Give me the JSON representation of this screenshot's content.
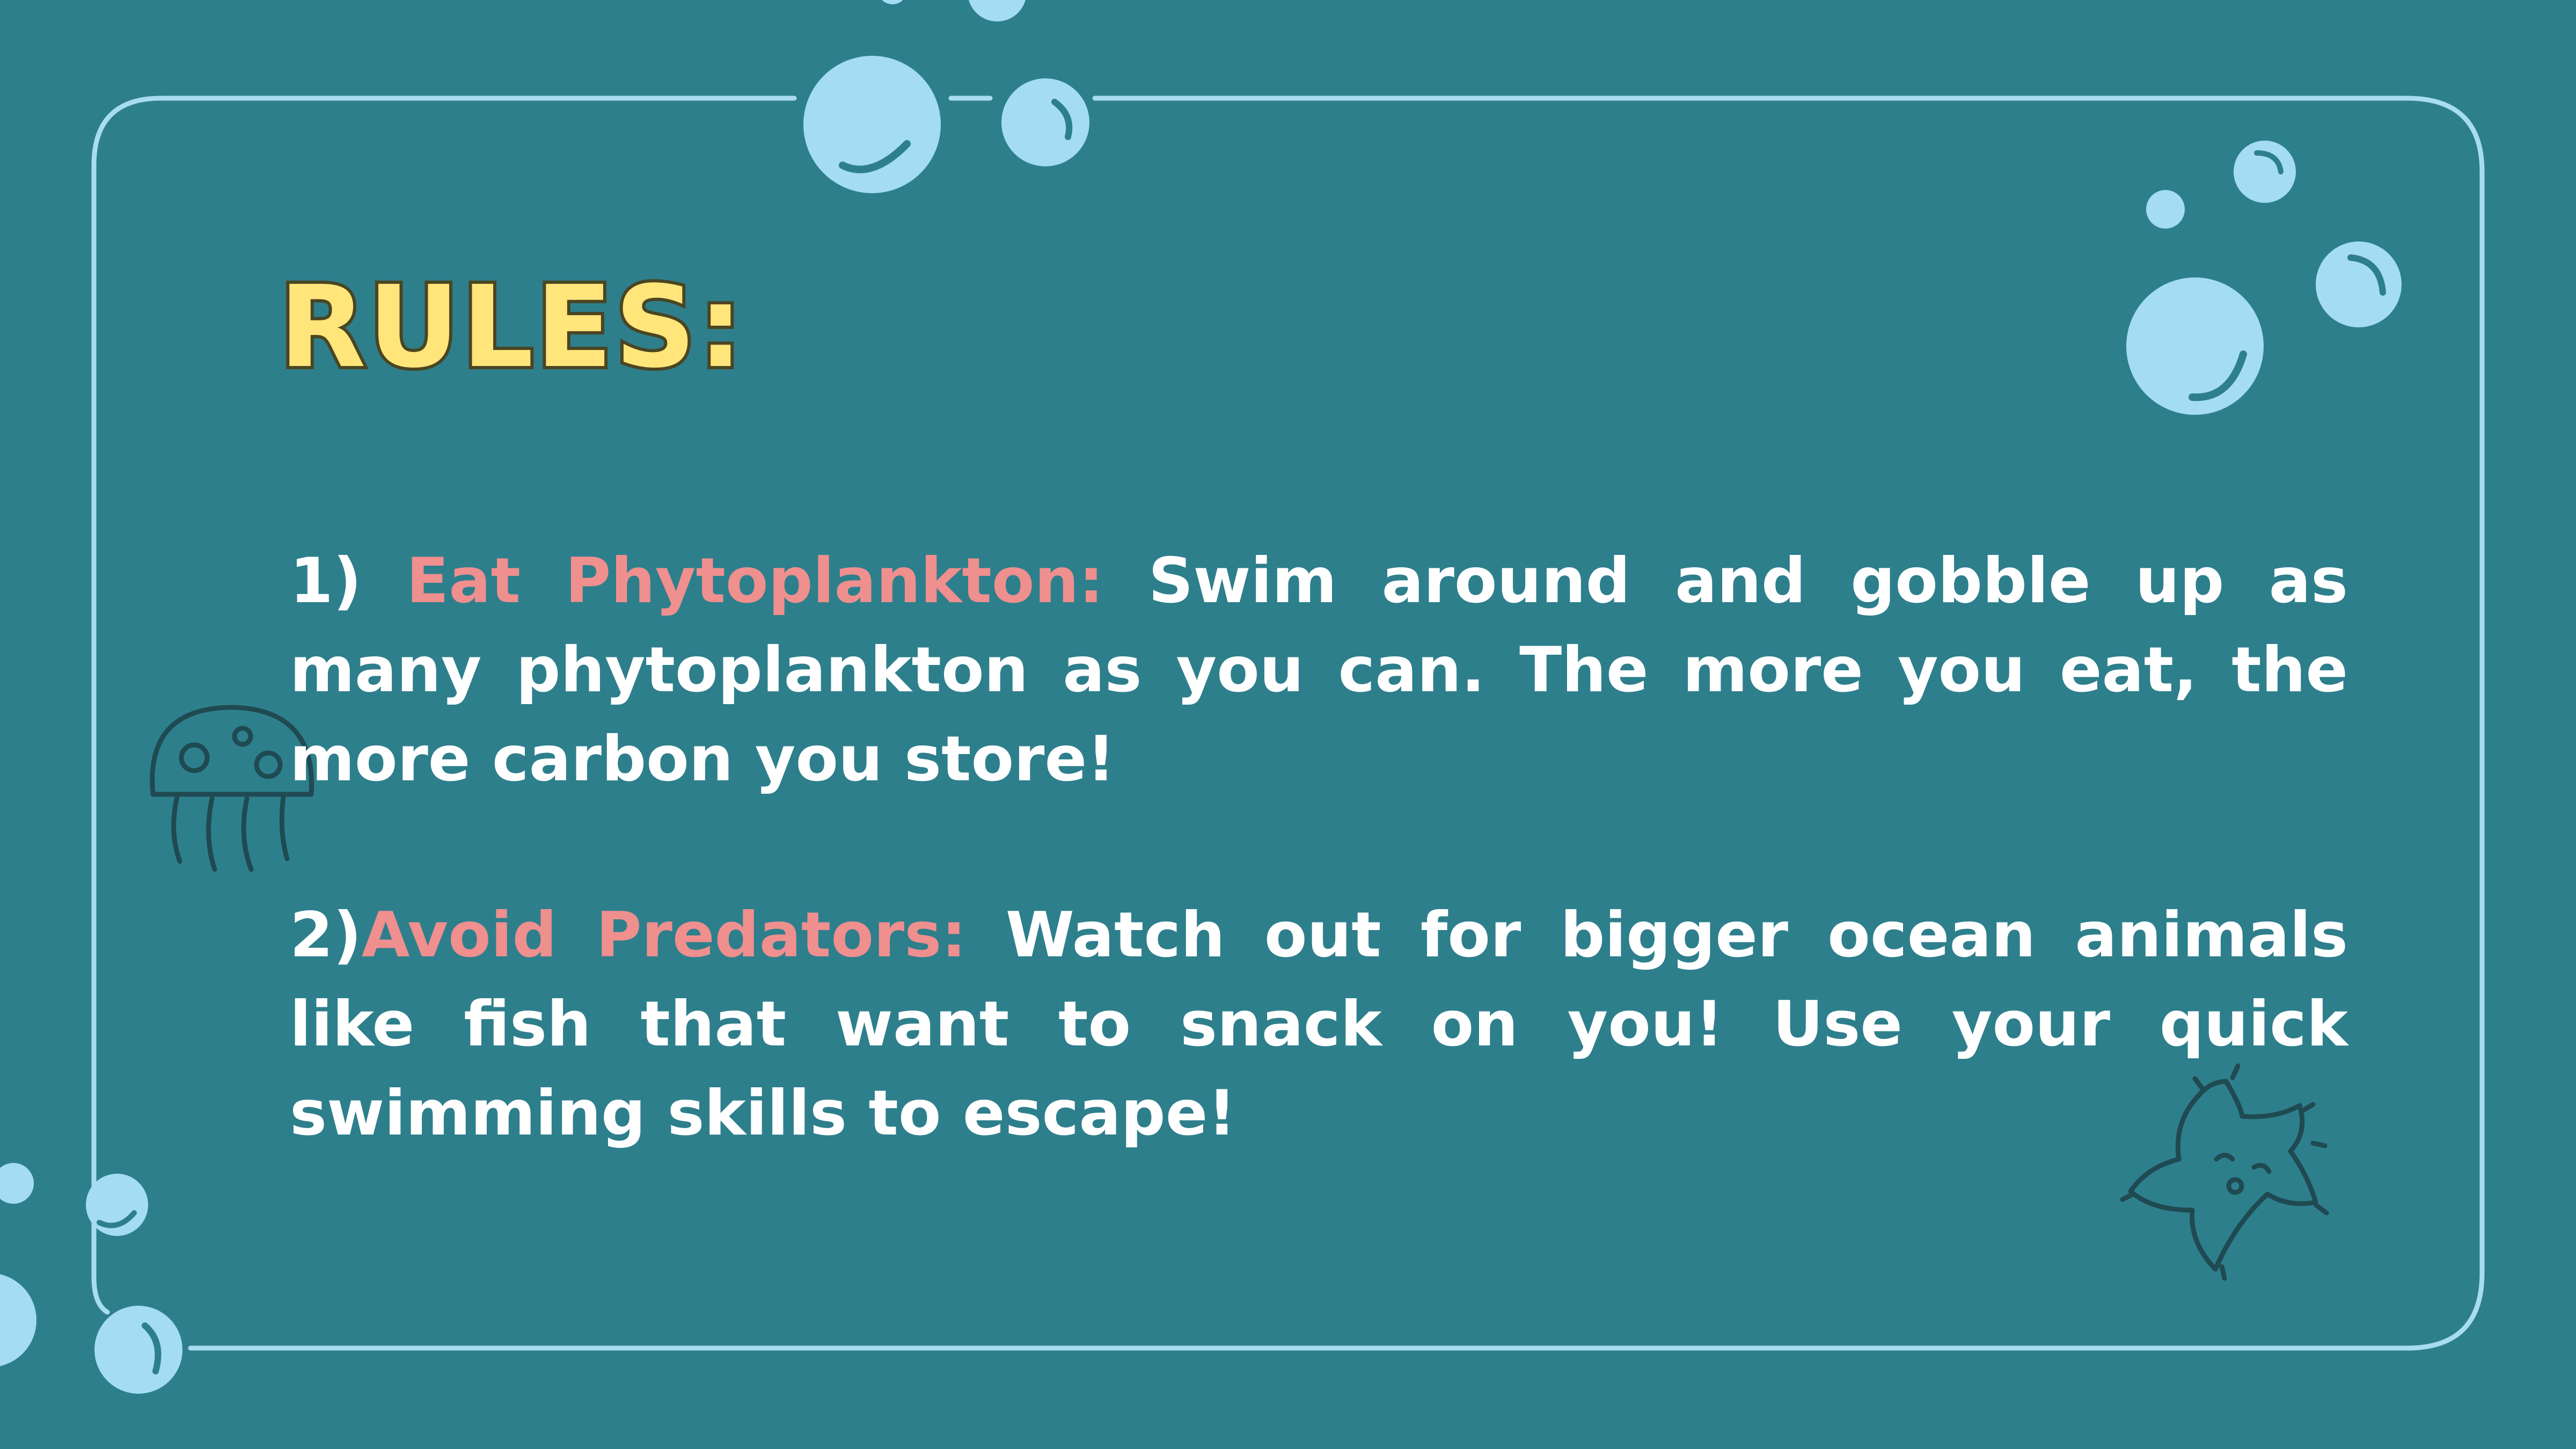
{
  "title": "RULES:",
  "rules": [
    {
      "number": "1)",
      "heading": "Eat Phytoplankton:",
      "text": "Swim around and gobble up as many phytoplankton as you can. The more you eat, the more carbon you store!"
    },
    {
      "number": "2)",
      "heading": "Avoid Predators:",
      "text": "Watch out for bigger ocean animals like fish that want to snack on you! Use your quick swimming skills to escape!"
    }
  ],
  "colors": {
    "background": "#2e7f8c",
    "frame": "#a8dcf2",
    "bubble": "#a3dcf3",
    "title_fill": "#ffe57a",
    "title_outline": "#4a4522",
    "rule_heading": "#ef8f8e",
    "rule_text": "#ffffff",
    "doodle_stroke": "#1f4a52"
  },
  "decorations": [
    "bubble-icon",
    "jellyfish-icon",
    "starfish-icon"
  ]
}
